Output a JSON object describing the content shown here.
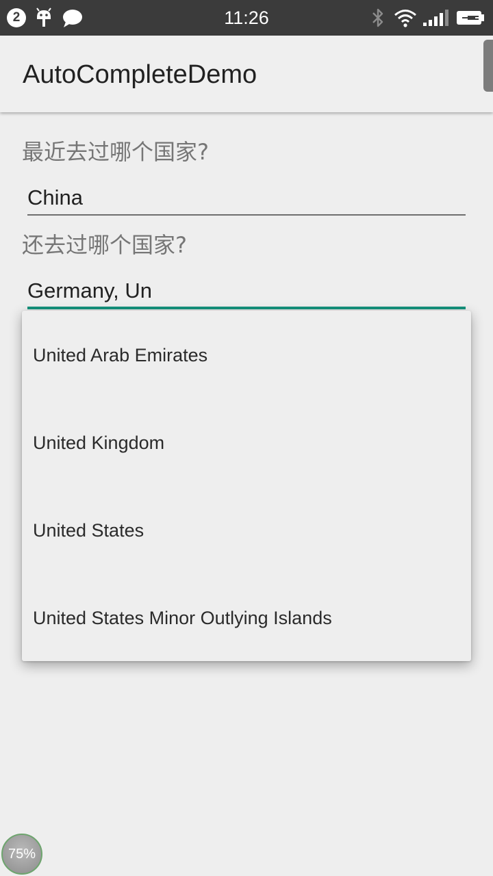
{
  "status_bar": {
    "notification_count": "2",
    "time": "11:26",
    "icons": [
      "android-debug-icon",
      "message-icon",
      "bluetooth-icon",
      "wifi-icon",
      "signal-icon",
      "battery-charging-icon"
    ]
  },
  "action_bar": {
    "title": "AutoCompleteDemo"
  },
  "form": {
    "question1_label": "最近去过哪个国家?",
    "country_field_value": "China",
    "question2_label": "还去过哪个国家?",
    "countries_field_value": "Germany, Un"
  },
  "dropdown": {
    "items": [
      {
        "label": "United Arab Emirates"
      },
      {
        "label": "United Kingdom"
      },
      {
        "label": "United States"
      },
      {
        "label": "United States Minor Outlying Islands"
      }
    ]
  },
  "floating_bubble": {
    "text": "75%"
  },
  "colors": {
    "status_bar": "#3b3b3b",
    "background": "#eeeeee",
    "focus_accent": "#14927c",
    "divider": "#6e6e6e"
  }
}
